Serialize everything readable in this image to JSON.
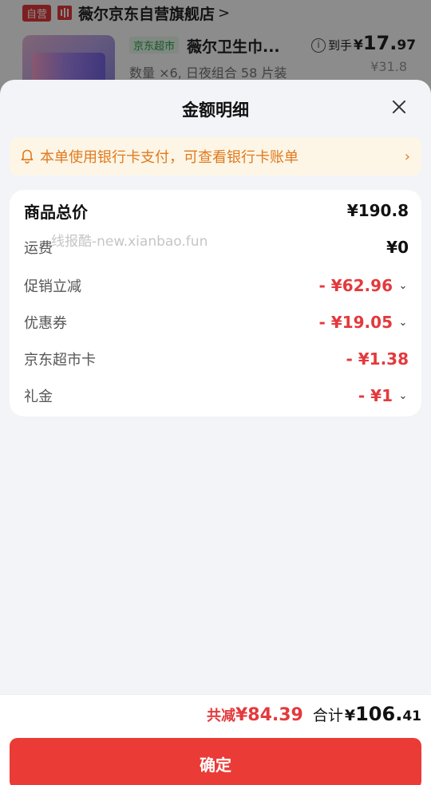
{
  "background": {
    "self_tag": "自营",
    "store_name": "薇尔京东自营旗舰店",
    "store_chevron": ">",
    "jd_supermarket_tag": "京东超市",
    "product_title": "薇尔卫生巾...",
    "product_spec": "数量 ×6, 日夜组合 58 片装",
    "price_label": "到手",
    "price_symbol": "¥",
    "price_int": "17.",
    "price_dec": "97",
    "original_price": "¥31.8"
  },
  "sheet": {
    "title": "金额明细",
    "notice": "本单使用银行卡支付，可查看银行卡账单",
    "notice_arrow": "›",
    "watermark": "线报酷-new.xianbao.fun",
    "rows": [
      {
        "label": "商品总价",
        "value": "¥190.8"
      },
      {
        "label": "运费",
        "value": "¥0"
      },
      {
        "label": "促销立减",
        "value": "- ¥62.96",
        "caret": "⌄"
      },
      {
        "label": "优惠券",
        "value": "- ¥19.05",
        "caret": "⌄"
      },
      {
        "label": "京东超市卡",
        "value": "- ¥1.38"
      },
      {
        "label": "礼金",
        "value": "- ¥1",
        "caret": "⌄"
      }
    ]
  },
  "footer": {
    "reduce_label": "共减",
    "reduce_value": "¥84.39",
    "total_label": "合计",
    "total_symbol": "¥",
    "total_int": "106.",
    "total_dec": "41",
    "confirm_label": "确定"
  },
  "colors": {
    "accent_red": "#e4393c",
    "notice_orange": "#e07a1f",
    "notice_bg": "#fdf6e6"
  }
}
